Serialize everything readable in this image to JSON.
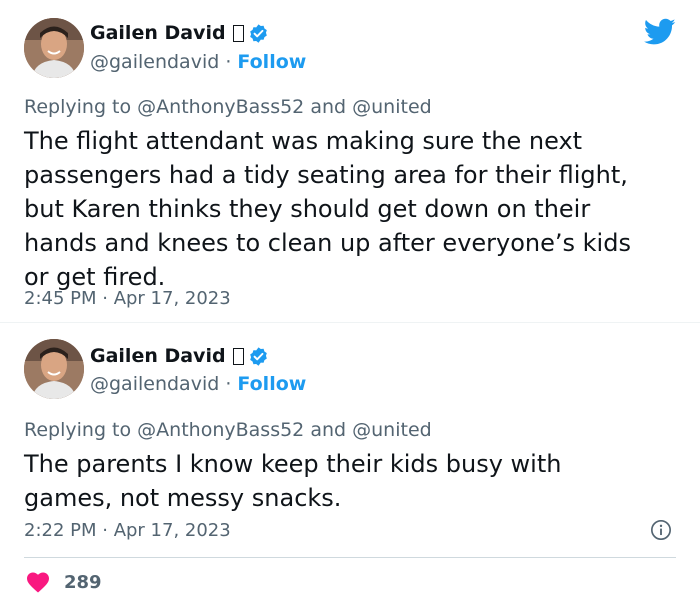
{
  "tweets": [
    {
      "author": {
        "name": "Gailen David",
        "handle": "@gailendavid",
        "follow_label": "Follow",
        "separator": "·"
      },
      "reply": {
        "prefix": "Replying to",
        "mention1": "@AnthonyBass52",
        "conjunction": "and",
        "mention2": "@united"
      },
      "text": "The flight attendant was making sure the next\npassengers had a tidy seating area for their flight,\nbut Karen thinks they should get down on their\nhands and knees to clean up after everyone’s kids\nor get fired.",
      "timestamp": "2:45 PM · Apr 17, 2023"
    },
    {
      "author": {
        "name": "Gailen David",
        "handle": "@gailendavid",
        "follow_label": "Follow",
        "separator": "·"
      },
      "reply": {
        "prefix": "Replying to",
        "mention1": "@AnthonyBass52",
        "conjunction": "and",
        "mention2": "@united"
      },
      "text": "The parents I know keep their kids busy with\ngames, not messy snacks.",
      "timestamp": "2:22 PM · Apr 17, 2023",
      "likes": "289"
    }
  ],
  "icons": {
    "platform": "twitter-bird-icon",
    "verified": "verified-badge-icon",
    "info": "info-icon",
    "like": "heart-icon"
  },
  "colors": {
    "brand": "#1d9bf0",
    "text": "#0f1419",
    "secondary": "#536471",
    "heart": "#f91880"
  }
}
